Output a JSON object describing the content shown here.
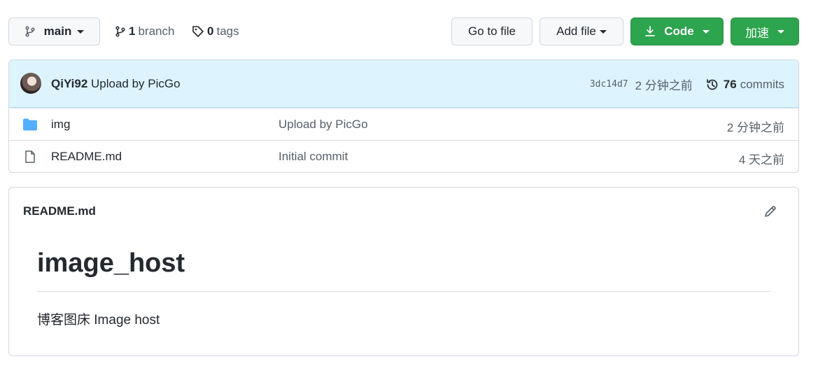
{
  "toolbar": {
    "branch_button_label": "main",
    "branches_count": "1",
    "branches_label": "branch",
    "tags_count": "0",
    "tags_label": "tags",
    "go_to_file_label": "Go to file",
    "add_file_label": "Add file",
    "code_label": "Code",
    "accelerate_label": "加速"
  },
  "latest_commit": {
    "author": "QiYi92",
    "message": "Upload by PicGo",
    "sha": "3dc14d7",
    "age": "2 分钟之前",
    "commits_count": "76",
    "commits_label": "commits"
  },
  "files": [
    {
      "name": "img",
      "type": "folder",
      "commit_message": "Upload by PicGo",
      "age": "2 分钟之前"
    },
    {
      "name": "README.md",
      "type": "file",
      "commit_message": "Initial commit",
      "age": "4 天之前"
    }
  ],
  "readme": {
    "file_name": "README.md",
    "heading": "image_host",
    "body": "博客图床 Image host"
  },
  "colors": {
    "primary_green": "#2da44e",
    "header_blue": "#ddf4ff",
    "folder_icon": "#54aeff"
  }
}
